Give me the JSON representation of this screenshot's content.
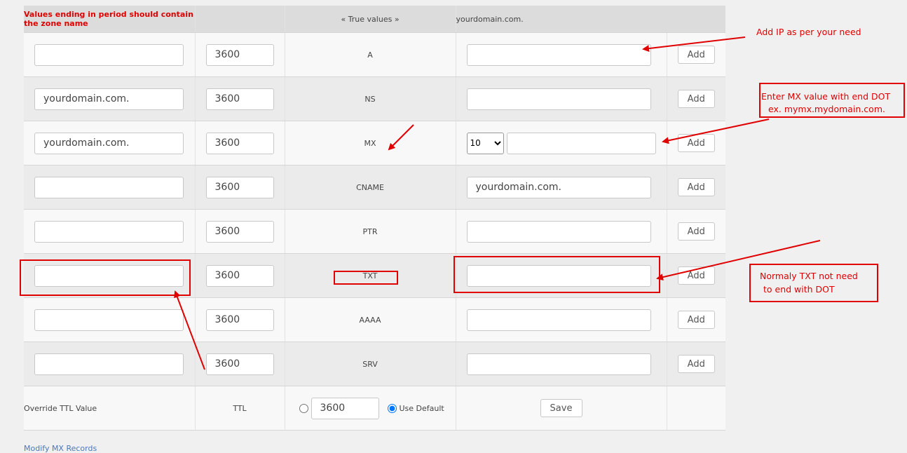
{
  "header": {
    "warning": "Values ending in period should contain the zone name",
    "true_values": "« True values »",
    "domain": "yourdomain.com."
  },
  "records": [
    {
      "name": "",
      "ttl": "3600",
      "type": "A",
      "value": "",
      "add": "Add"
    },
    {
      "name": "yourdomain.com.",
      "ttl": "3600",
      "type": "NS",
      "value": "",
      "add": "Add"
    },
    {
      "name": "yourdomain.com.",
      "ttl": "3600",
      "type": "MX",
      "priority": "10",
      "value": "",
      "add": "Add"
    },
    {
      "name": "",
      "ttl": "3600",
      "type": "CNAME",
      "value": "yourdomain.com.",
      "add": "Add"
    },
    {
      "name": "",
      "ttl": "3600",
      "type": "PTR",
      "value": "",
      "add": "Add"
    },
    {
      "name": "",
      "ttl": "3600",
      "type": "TXT",
      "value": "",
      "add": "Add"
    },
    {
      "name": "",
      "ttl": "3600",
      "type": "AAAA",
      "value": "",
      "add": "Add"
    },
    {
      "name": "",
      "ttl": "3600",
      "type": "SRV",
      "value": "",
      "add": "Add"
    }
  ],
  "override": {
    "label": "Override TTL Value",
    "ttl_label": "TTL",
    "ttl_value": "3600",
    "use_default": "Use Default",
    "save": "Save"
  },
  "footer": {
    "modify_mx": "Modify MX Records"
  },
  "annotations": {
    "add_ip": "Add IP as per your need",
    "mx_line1": "Enter MX value with end DOT",
    "mx_line2": "ex.  mymx.mydomain.com.",
    "txt_line1": "Normaly TXT not need",
    "txt_line2": "to end with DOT"
  },
  "colors": {
    "annotation": "#e00000",
    "header_bg": "#dcdcdc",
    "link": "#4a78b8"
  }
}
